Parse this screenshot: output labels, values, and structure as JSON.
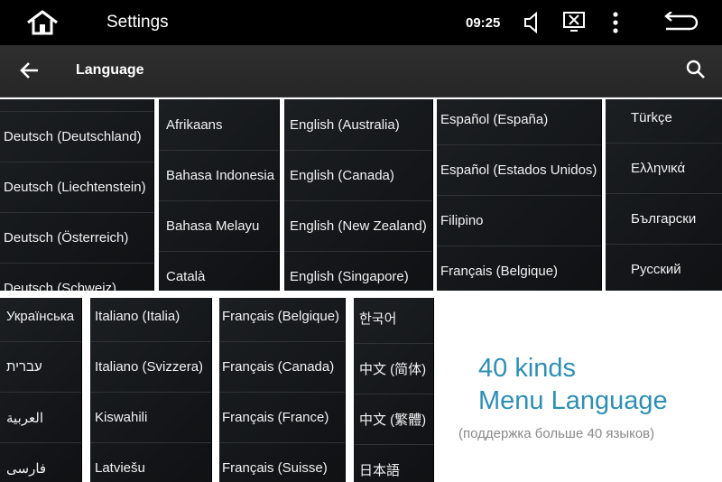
{
  "status_bar": {
    "title": "Settings",
    "time": "09:25",
    "icons": [
      "home-icon",
      "volume-icon",
      "close-window-icon",
      "more-vert-icon",
      "back-return-icon"
    ]
  },
  "action_bar": {
    "title": "Language",
    "icons": [
      "arrow-back-icon",
      "search-icon"
    ]
  },
  "panels_top": [
    {
      "items": [
        "Deutsch (Deutschland)",
        "Deutsch (Liechtenstein)",
        "Deutsch (Österreich)",
        "Deutsch (Schweiz)"
      ]
    },
    {
      "items": [
        "Afrikaans",
        "Bahasa Indonesia",
        "Bahasa Melayu",
        "Català"
      ]
    },
    {
      "items": [
        "English (Australia)",
        "English (Canada)",
        "English (New Zealand)",
        "English (Singapore)"
      ]
    },
    {
      "items": [
        "Español (España)",
        "Español (Estados Unidos)",
        "Filipino",
        "Français (Belgique)"
      ]
    },
    {
      "items": [
        "Türkçe",
        "Ελληνικά",
        "Български",
        "Русский"
      ]
    }
  ],
  "panels_bottom": [
    {
      "items": [
        "Українська",
        "עברית",
        "العربية",
        "فارسی"
      ]
    },
    {
      "items": [
        "Italiano (Italia)",
        "Italiano (Svizzera)",
        "Kiswahili",
        "Latviešu"
      ]
    },
    {
      "items": [
        "Français (Belgique)",
        "Français (Canada)",
        "Français (France)",
        "Français (Suisse)"
      ]
    },
    {
      "items": [
        "한국어",
        "中文 (简体)",
        "中文 (繁體)",
        "日本語"
      ]
    }
  ],
  "caption": {
    "line1": "40 kinds",
    "line2": "Menu Language",
    "line3": "(поддержка больше 40 языков)"
  }
}
